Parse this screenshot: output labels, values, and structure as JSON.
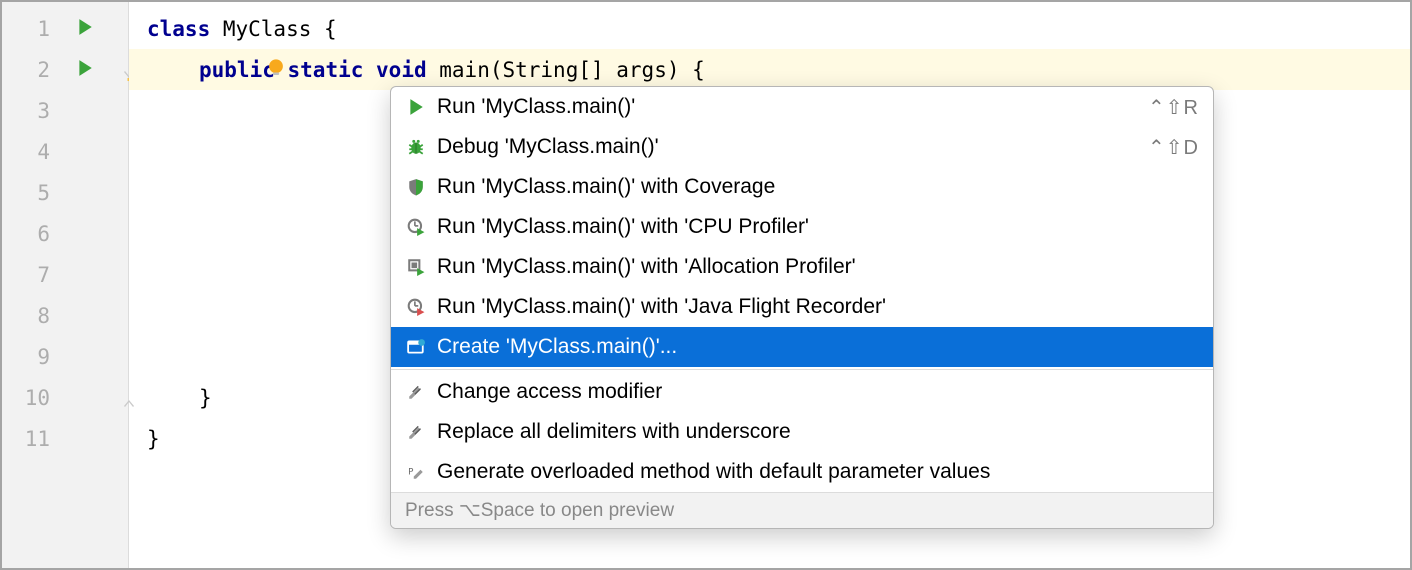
{
  "gutter": {
    "lines": [
      "1",
      "2",
      "3",
      "4",
      "5",
      "6",
      "7",
      "8",
      "9",
      "10",
      "11"
    ]
  },
  "code": {
    "line1": {
      "kw": "class",
      "ident": " MyClass ",
      "brace": "{"
    },
    "line2": {
      "indent": "    ",
      "kw1": "public",
      "sp1": " ",
      "kw2": "static",
      "sp2": " ",
      "kw3": "void",
      "sp3": " ",
      "ident": "main(String[] args) ",
      "brace": "{"
    },
    "line3_tail": ");",
    "line10": {
      "indent": "    ",
      "brace": "}"
    },
    "line11": {
      "brace": "}"
    }
  },
  "popup": {
    "items": [
      {
        "icon": "run-icon",
        "label": "Run 'MyClass.main()'",
        "shortcut": "⌃⇧R"
      },
      {
        "icon": "debug-icon",
        "label": "Debug 'MyClass.main()'",
        "shortcut": "⌃⇧D"
      },
      {
        "icon": "coverage-icon",
        "label": "Run 'MyClass.main()' with Coverage",
        "shortcut": ""
      },
      {
        "icon": "cpu-profiler-icon",
        "label": "Run 'MyClass.main()' with 'CPU Profiler'",
        "shortcut": ""
      },
      {
        "icon": "alloc-profiler-icon",
        "label": "Run 'MyClass.main()' with 'Allocation Profiler'",
        "shortcut": ""
      },
      {
        "icon": "jfr-icon",
        "label": "Run 'MyClass.main()' with 'Java Flight Recorder'",
        "shortcut": ""
      },
      {
        "icon": "create-config-icon",
        "label": "Create 'MyClass.main()'...",
        "shortcut": "",
        "selected": true
      }
    ],
    "items2": [
      {
        "icon": "intention-icon",
        "label": "Change access modifier"
      },
      {
        "icon": "intention-icon",
        "label": "Replace all delimiters with underscore"
      },
      {
        "icon": "intention-params-icon",
        "label": "Generate overloaded method with default parameter values"
      }
    ],
    "footer": "Press ⌥Space to open preview"
  }
}
